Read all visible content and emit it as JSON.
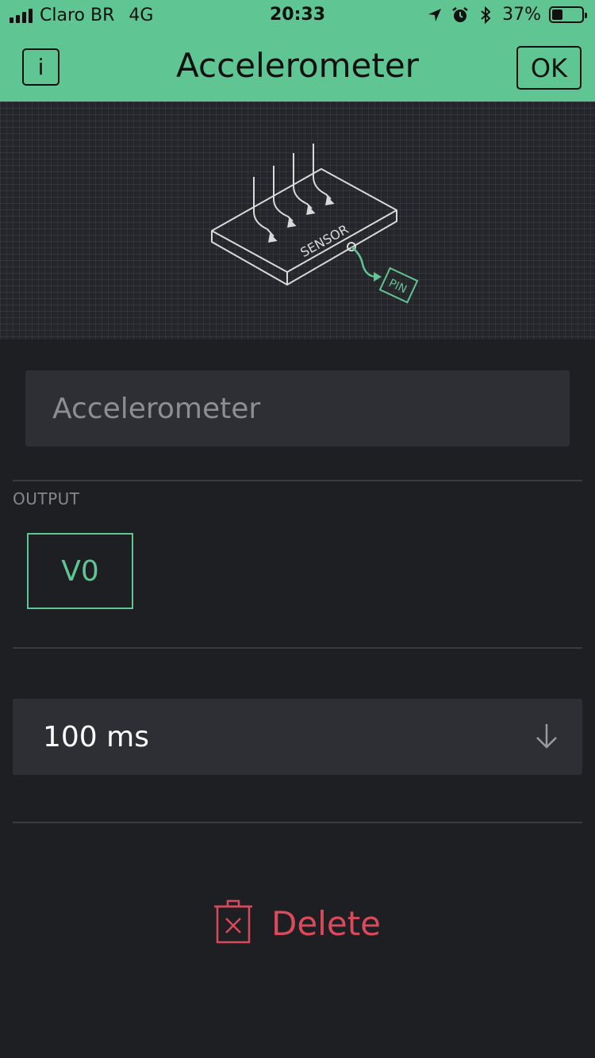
{
  "status_bar": {
    "carrier": "Claro BR",
    "network": "4G",
    "time": "20:33",
    "battery_percent": "37%",
    "battery_level": 0.37,
    "icons": [
      "signal-icon",
      "location-arrow-icon",
      "alarm-icon",
      "bluetooth-icon",
      "battery-icon"
    ]
  },
  "nav": {
    "info_label": "i",
    "title": "Accelerometer",
    "ok_label": "OK"
  },
  "illustration": {
    "sensor_label": "SENSOR",
    "pin_label": "PIN"
  },
  "name_field": {
    "placeholder": "Accelerometer",
    "value": ""
  },
  "output": {
    "label": "OUTPUT",
    "pin": "V0"
  },
  "interval": {
    "selected": "100 ms"
  },
  "delete": {
    "label": "Delete"
  },
  "colors": {
    "accent": "#5fc592",
    "background": "#1e1f23",
    "field": "#2e2f34",
    "danger": "#d94a5c"
  }
}
